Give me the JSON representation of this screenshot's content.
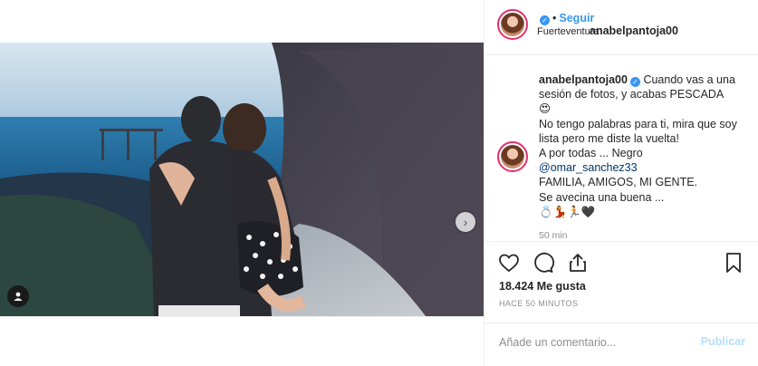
{
  "post": {
    "username": "anabelpantoja00",
    "verified_mark": "✓",
    "follow_label": "Seguir",
    "separator": "•",
    "location": "Fuerteventura"
  },
  "caption": {
    "username": "anabelpantoja00",
    "line1": "Cuando vas a una sesión de fotos, y acabas PESCADA",
    "emoji1": "😍",
    "line2": "No tengo palabras para ti, mira que soy lista pero me diste la vuelta!",
    "line3": "A por todas ... Negro",
    "mention": "@omar_sanchez33",
    "line4": "FAMILIA, AMIGOS, MI GENTE.",
    "line5": "Se avecina una buena ...",
    "emoji2": "💍💃🏃🖤",
    "time": "50 min"
  },
  "stats": {
    "likes": "18.424 Me gusta",
    "posted": "HACE 50 MINUTOS"
  },
  "comment_box": {
    "placeholder": "Añade un comentario...",
    "publish_label": "Publicar"
  },
  "media": {
    "next_arrow": "›"
  },
  "colors": {
    "accent_blue": "#3897f0",
    "publish_disabled": "#b2dffc",
    "story_ring": "#e1306c"
  },
  "icons": [
    "heart-icon",
    "comment-icon",
    "share-icon",
    "bookmark-icon",
    "user-tag-icon",
    "chevron-right-icon",
    "verified-badge-icon"
  ]
}
